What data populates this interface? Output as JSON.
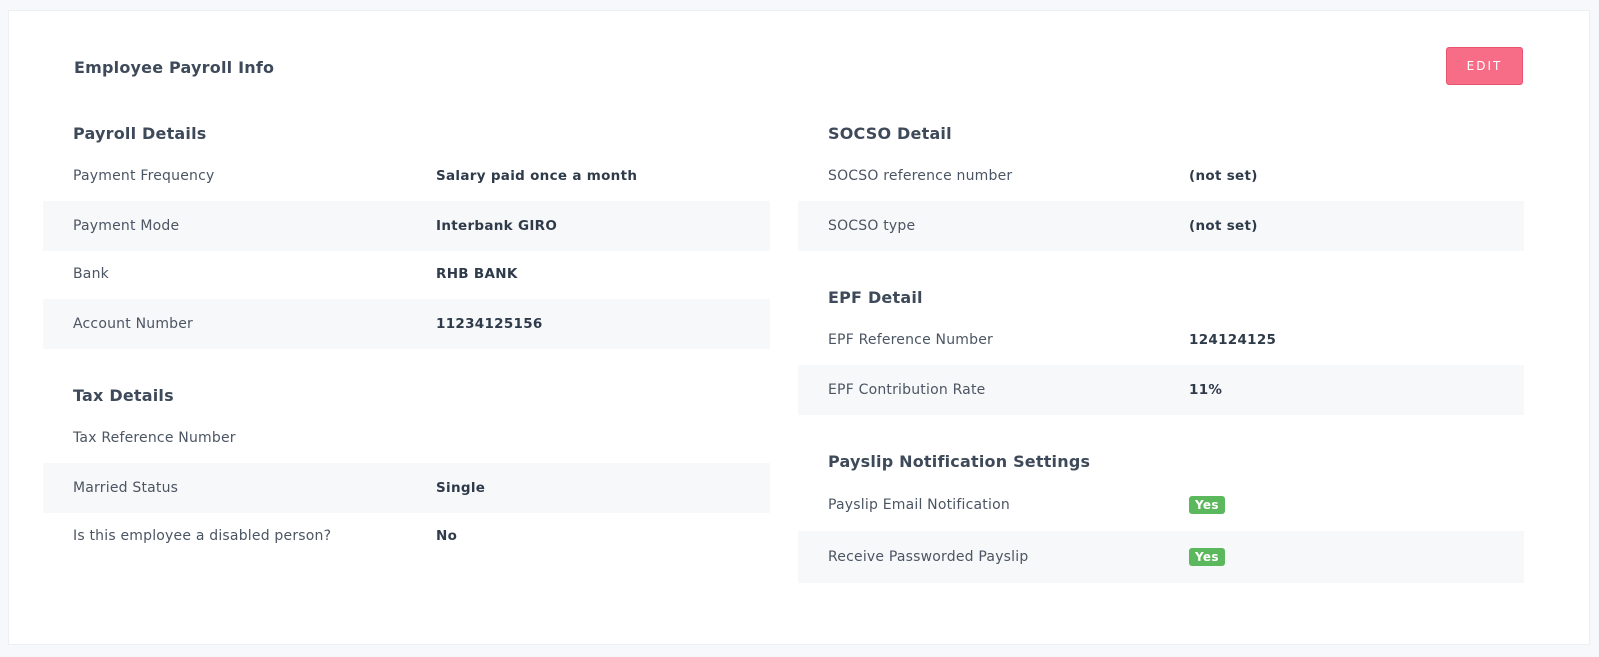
{
  "card": {
    "title": "Employee Payroll Info",
    "edit_label": "EDIT"
  },
  "payroll": {
    "title": "Payroll Details",
    "rows": [
      {
        "label": "Payment Frequency",
        "value": "Salary paid once a month"
      },
      {
        "label": "Payment Mode",
        "value": "Interbank GIRO"
      },
      {
        "label": "Bank",
        "value": "RHB BANK"
      },
      {
        "label": "Account Number",
        "value": "11234125156"
      }
    ]
  },
  "tax": {
    "title": "Tax Details",
    "rows": [
      {
        "label": "Tax Reference Number",
        "value": ""
      },
      {
        "label": "Married Status",
        "value": "Single"
      },
      {
        "label": "Is this employee a disabled person?",
        "value": "No"
      }
    ]
  },
  "socso": {
    "title": "SOCSO Detail",
    "rows": [
      {
        "label": "SOCSO reference number",
        "value": "(not set)"
      },
      {
        "label": "SOCSO type",
        "value": "(not set)"
      }
    ]
  },
  "epf": {
    "title": "EPF Detail",
    "rows": [
      {
        "label": "EPF Reference Number",
        "value": "124124125"
      },
      {
        "label": "EPF Contribution Rate",
        "value": "11%"
      }
    ]
  },
  "payslip": {
    "title": "Payslip Notification Settings",
    "rows": [
      {
        "label": "Payslip Email Notification",
        "value": "Yes"
      },
      {
        "label": "Receive Passworded Payslip",
        "value": "Yes"
      }
    ]
  },
  "colors": {
    "accent": "#f76c86",
    "badge_green": "#5cb85c",
    "row_alt": "#f7f8f9"
  }
}
